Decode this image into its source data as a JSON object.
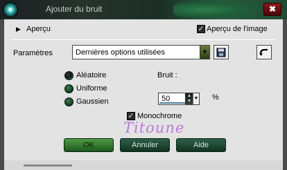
{
  "window": {
    "title": "Ajouter du bruit",
    "close_glyph": "✖"
  },
  "preview": {
    "label": "Aperçu",
    "toggle_glyph": "▶",
    "image_preview_label": "Aperçu de l'image",
    "image_preview_checked": true
  },
  "settings": {
    "label": "Paramètres",
    "preset_value": "Dernières options utilisées",
    "dropdown_glyph": "▼",
    "save_icon": "save-icon",
    "reset_icon": "undo-arrow-icon"
  },
  "distribution": {
    "options": [
      "Aléatoire",
      "Uniforme",
      "Gaussien"
    ],
    "selected": "Aléatoire"
  },
  "noise": {
    "label": "Bruit :",
    "value": "50",
    "unit": "%",
    "monochrome_label": "Monochrome",
    "monochrome_checked": true
  },
  "buttons": {
    "ok": "OK",
    "cancel": "Annuler",
    "help": "Aide"
  },
  "watermark": "Titoune",
  "colors": {
    "panel": "#e3e3e3",
    "ok_button": "#3f8a3a",
    "dark_button": "#1f4a35",
    "titlebar_accent": "#255a3e"
  }
}
